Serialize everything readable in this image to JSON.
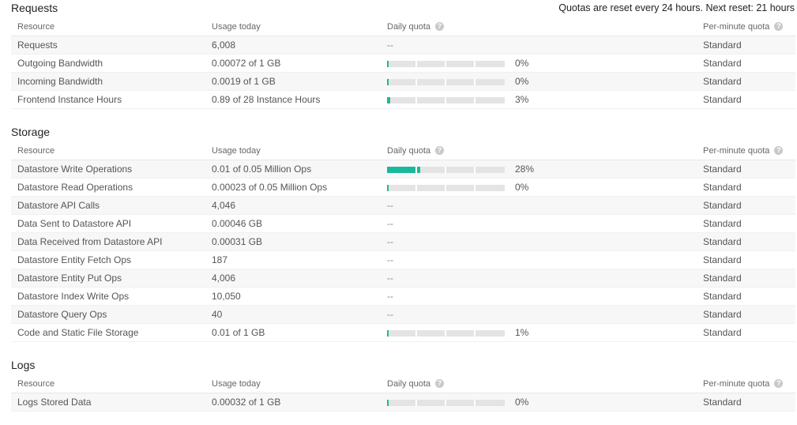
{
  "reset_note": "Quotas are reset every 24 hours. Next reset: 21 hours",
  "columns": {
    "resource": "Resource",
    "usage": "Usage today",
    "daily": "Daily quota",
    "perminute": "Per-minute quota",
    "help_glyph": "?"
  },
  "colors": {
    "bar_fill": "#1ab89a",
    "bar_track": "#e4e4e4"
  },
  "sections": [
    {
      "title": "Requests",
      "rows": [
        {
          "resource": "Requests",
          "usage": "6,008",
          "quota": null,
          "quota_text": "--",
          "perminute": "Standard"
        },
        {
          "resource": "Outgoing Bandwidth",
          "usage": "0.00072 of 1 GB",
          "quota": 0,
          "quota_text": "0%",
          "perminute": "Standard"
        },
        {
          "resource": "Incoming Bandwidth",
          "usage": "0.0019 of 1 GB",
          "quota": 0,
          "quota_text": "0%",
          "perminute": "Standard"
        },
        {
          "resource": "Frontend Instance Hours",
          "usage": "0.89 of 28 Instance Hours",
          "quota": 3,
          "quota_text": "3%",
          "perminute": "Standard"
        }
      ]
    },
    {
      "title": "Storage",
      "rows": [
        {
          "resource": "Datastore Write Operations",
          "usage": "0.01 of 0.05 Million Ops",
          "quota": 28,
          "quota_text": "28%",
          "perminute": "Standard"
        },
        {
          "resource": "Datastore Read Operations",
          "usage": "0.00023 of 0.05 Million Ops",
          "quota": 0.5,
          "quota_text": "0%",
          "perminute": "Standard"
        },
        {
          "resource": "Datastore API Calls",
          "usage": "4,046",
          "quota": null,
          "quota_text": "--",
          "perminute": "Standard"
        },
        {
          "resource": "Data Sent to Datastore API",
          "usage": "0.00046 GB",
          "quota": null,
          "quota_text": "--",
          "perminute": "Standard"
        },
        {
          "resource": "Data Received from Datastore API",
          "usage": "0.00031 GB",
          "quota": null,
          "quota_text": "--",
          "perminute": "Standard"
        },
        {
          "resource": "Datastore Entity Fetch Ops",
          "usage": "187",
          "quota": null,
          "quota_text": "--",
          "perminute": "Standard"
        },
        {
          "resource": "Datastore Entity Put Ops",
          "usage": "4,006",
          "quota": null,
          "quota_text": "--",
          "perminute": "Standard"
        },
        {
          "resource": "Datastore Index Write Ops",
          "usage": "10,050",
          "quota": null,
          "quota_text": "--",
          "perminute": "Standard"
        },
        {
          "resource": "Datastore Query Ops",
          "usage": "40",
          "quota": null,
          "quota_text": "--",
          "perminute": "Standard"
        },
        {
          "resource": "Code and Static File Storage",
          "usage": "0.01 of 1 GB",
          "quota": 1,
          "quota_text": "1%",
          "perminute": "Standard"
        }
      ]
    },
    {
      "title": "Logs",
      "rows": [
        {
          "resource": "Logs Stored Data",
          "usage": "0.00032 of 1 GB",
          "quota": 0,
          "quota_text": "0%",
          "perminute": "Standard"
        }
      ]
    }
  ]
}
